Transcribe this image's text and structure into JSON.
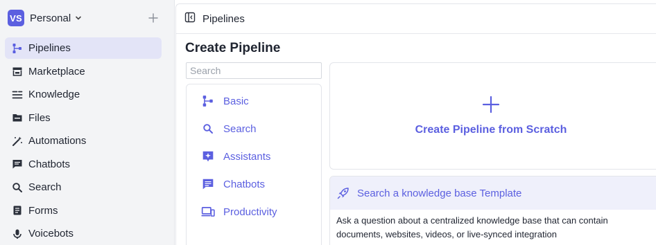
{
  "workspace": {
    "initials": "VS",
    "name": "Personal"
  },
  "sidebar": {
    "items": [
      {
        "label": "Pipelines",
        "icon": "pipeline-icon",
        "active": true
      },
      {
        "label": "Marketplace",
        "icon": "store-icon"
      },
      {
        "label": "Knowledge",
        "icon": "list-icon"
      },
      {
        "label": "Files",
        "icon": "folder-icon"
      },
      {
        "label": "Automations",
        "icon": "magic-wand-icon"
      },
      {
        "label": "Chatbots",
        "icon": "chat-icon"
      },
      {
        "label": "Search",
        "icon": "search-icon"
      },
      {
        "label": "Forms",
        "icon": "form-icon"
      },
      {
        "label": "Voicebots",
        "icon": "voice-icon"
      }
    ]
  },
  "header": {
    "breadcrumb": "Pipelines"
  },
  "page": {
    "title": "Create Pipeline"
  },
  "search": {
    "placeholder": "Search",
    "value": ""
  },
  "categories": [
    {
      "label": "Basic",
      "icon": "pipeline-icon"
    },
    {
      "label": "Search",
      "icon": "search-icon"
    },
    {
      "label": "Assistants",
      "icon": "assistant-icon"
    },
    {
      "label": "Chatbots",
      "icon": "chat-icon"
    },
    {
      "label": "Productivity",
      "icon": "devices-icon"
    }
  ],
  "scratch": {
    "label": "Create Pipeline from Scratch"
  },
  "template": {
    "title": "Search a knowledge base Template",
    "description": "Ask a question about a centralized knowledge base that can contain documents, websites, videos, or live-synced integration"
  },
  "colors": {
    "accent": "#5b5fe0",
    "active_bg": "#e3e4f7",
    "sidebar_bg": "#f3f4f6"
  }
}
